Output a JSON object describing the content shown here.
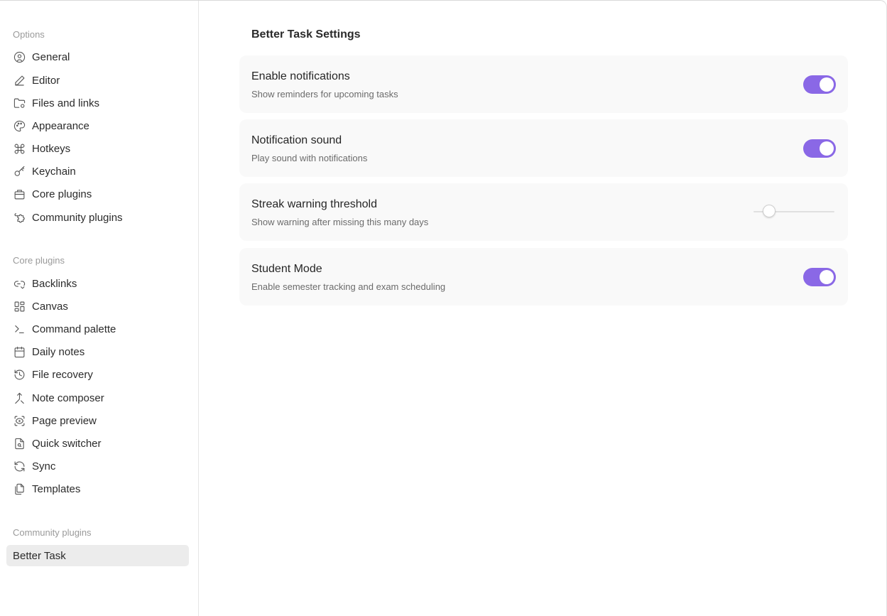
{
  "sidebar": {
    "options_title": "Options",
    "options": [
      {
        "label": "General",
        "icon": "user-circle-icon"
      },
      {
        "label": "Editor",
        "icon": "pencil-icon"
      },
      {
        "label": "Files and links",
        "icon": "folder-cog-icon"
      },
      {
        "label": "Appearance",
        "icon": "palette-icon"
      },
      {
        "label": "Hotkeys",
        "icon": "command-icon"
      },
      {
        "label": "Keychain",
        "icon": "key-icon"
      },
      {
        "label": "Core plugins",
        "icon": "briefcase-icon"
      },
      {
        "label": "Community plugins",
        "icon": "puzzle-icon"
      }
    ],
    "core_title": "Core plugins",
    "core": [
      {
        "label": "Backlinks",
        "icon": "backlink-icon"
      },
      {
        "label": "Canvas",
        "icon": "layout-grid-icon"
      },
      {
        "label": "Command palette",
        "icon": "terminal-icon"
      },
      {
        "label": "Daily notes",
        "icon": "calendar-icon"
      },
      {
        "label": "File recovery",
        "icon": "history-icon"
      },
      {
        "label": "Note composer",
        "icon": "merge-icon"
      },
      {
        "label": "Page preview",
        "icon": "scan-eye-icon"
      },
      {
        "label": "Quick switcher",
        "icon": "file-search-icon"
      },
      {
        "label": "Sync",
        "icon": "refresh-icon"
      },
      {
        "label": "Templates",
        "icon": "files-icon"
      }
    ],
    "community_title": "Community plugins",
    "community": [
      {
        "label": "Better Task",
        "active": true
      }
    ]
  },
  "main": {
    "title": "Better Task Settings",
    "settings": [
      {
        "name": "Enable notifications",
        "desc": "Show reminders for upcoming tasks",
        "control": "toggle",
        "value": true
      },
      {
        "name": "Notification sound",
        "desc": "Play sound with notifications",
        "control": "toggle",
        "value": true
      },
      {
        "name": "Streak warning threshold",
        "desc": "Show warning after missing this many days",
        "control": "slider",
        "value_fraction": 0.14
      },
      {
        "name": "Student Mode",
        "desc": "Enable semester tracking and exam scheduling",
        "control": "toggle",
        "value": true
      }
    ]
  },
  "colors": {
    "accent": "#8a68e6",
    "active_item_bg": "#ececec",
    "card_bg": "#f9f9f9"
  }
}
